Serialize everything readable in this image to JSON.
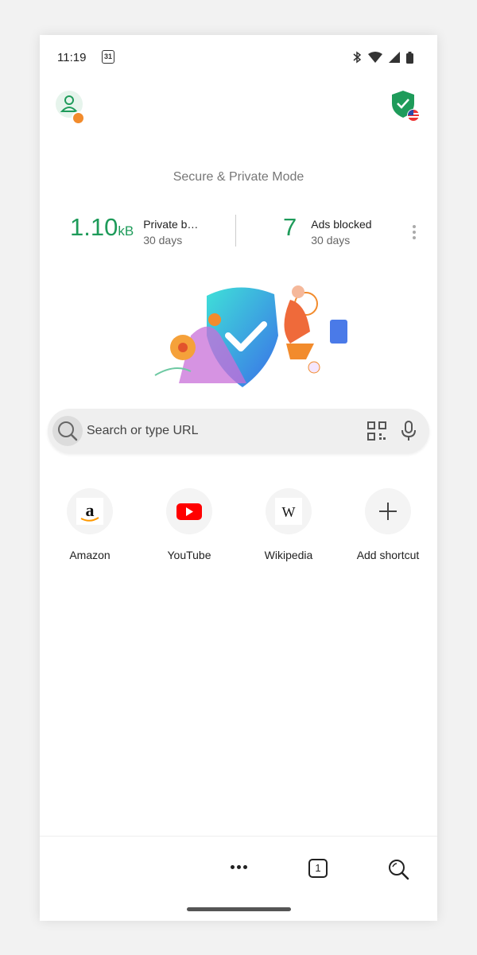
{
  "status": {
    "time": "11:19",
    "calendar_day": "31"
  },
  "header": {
    "title": "Secure & Private Mode"
  },
  "stats": {
    "data_value": "1.10",
    "data_unit": "kB",
    "data_label": "Private b…",
    "data_period": "30 days",
    "ads_value": "7",
    "ads_label": "Ads blocked",
    "ads_period": "30 days"
  },
  "search": {
    "placeholder": "Search or type URL"
  },
  "shortcuts": [
    {
      "label": "Amazon",
      "icon": "amazon-icon"
    },
    {
      "label": "YouTube",
      "icon": "youtube-icon"
    },
    {
      "label": "Wikipedia",
      "icon": "wikipedia-icon"
    },
    {
      "label": "Add shortcut",
      "icon": "plus-icon"
    }
  ],
  "bottom": {
    "tab_count": "1"
  },
  "colors": {
    "accent": "#1e9b5a",
    "youtube_red": "#ff0000",
    "shield_green": "#1e9b5a"
  }
}
